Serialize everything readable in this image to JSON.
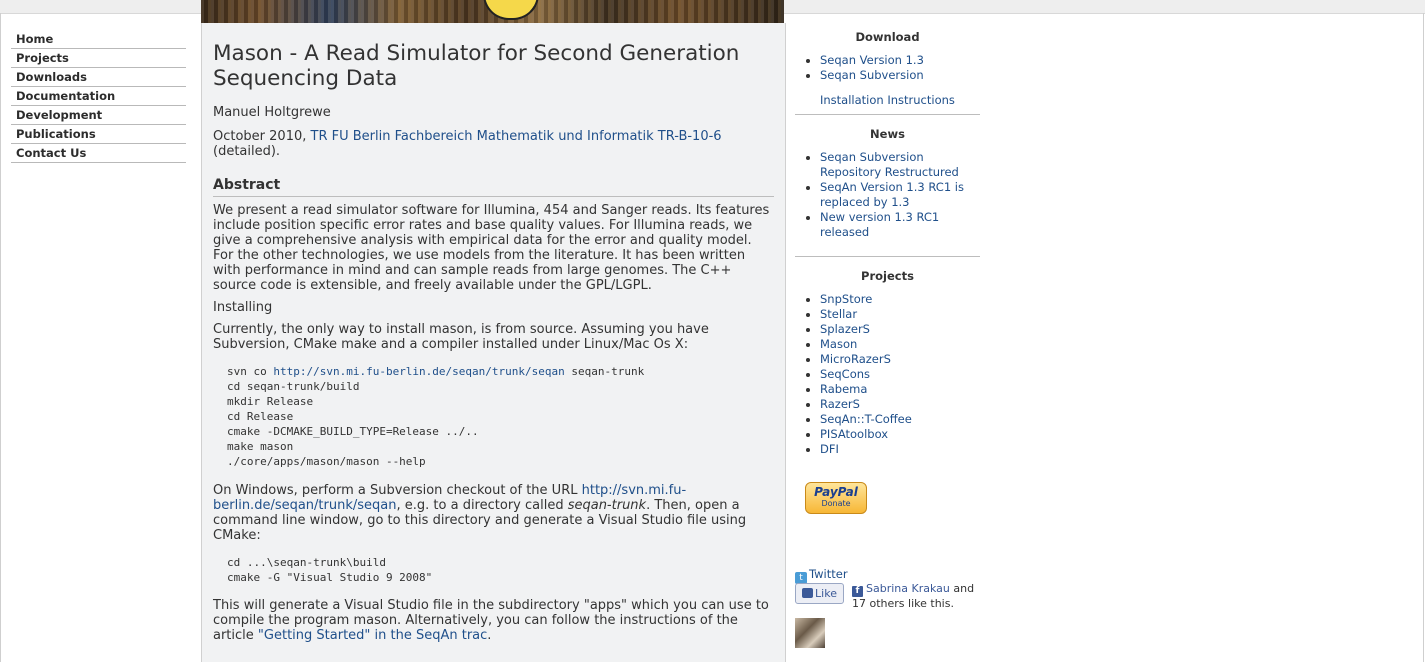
{
  "nav": {
    "items": [
      {
        "label": "Home"
      },
      {
        "label": "Projects"
      },
      {
        "label": "Downloads"
      },
      {
        "label": "Documentation"
      },
      {
        "label": "Development"
      },
      {
        "label": "Publications"
      },
      {
        "label": "Contact Us"
      }
    ]
  },
  "article": {
    "title": "Mason - A Read Simulator for Second Generation Sequencing Data",
    "author": "Manuel Holtgrewe",
    "date_prefix": "October 2010,",
    "report_link": "TR FU Berlin Fachbereich Mathematik und Informatik TR-B-10-6",
    "date_suffix": "(detailed).",
    "abstract_heading": "Abstract",
    "abstract_text": "We present a read simulator software for Illumina, 454 and Sanger reads. Its features include position specific error rates and base quality values. For Illumina reads, we give a comprehensive analysis with empirical data for the error and quality model. For the other technologies, we use models from the literature. It has been written with performance in mind and can sample reads from large genomes. The C++ source code is extensible, and freely available under the GPL/LGPL.",
    "installing_label": "Installing",
    "install_intro": "Currently, the only way to install mason, is from source. Assuming you have Subversion, CMake make and a compiler installed under Linux/Mac Os X:",
    "code1": {
      "line1_prefix": "svn co ",
      "line1_link": "http://svn.mi.fu-berlin.de/seqan/trunk/seqan",
      "line1_suffix": " seqan-trunk",
      "rest": "cd seqan-trunk/build\nmkdir Release\ncd Release\ncmake -DCMAKE_BUILD_TYPE=Release ../..\nmake mason\n./core/apps/mason/mason --help"
    },
    "windows_prefix": "On Windows, perform a Subversion checkout of the URL ",
    "windows_link": "http://svn.mi.fu-berlin.de/seqan/trunk/seqan",
    "windows_mid": ", e.g. to a directory called ",
    "windows_dir": "seqan-trunk",
    "windows_suffix": ". Then, open a command line window, go to this directory and generate a Visual Studio file using CMake:",
    "code2": "cd ...\\seqan-trunk\\build\ncmake -G \"Visual Studio 9 2008\"",
    "vs_prefix": "This will generate a Visual Studio file in the subdirectory \"apps\" which you can use to compile the program mason. Alternatively, you can follow the instructions of the article ",
    "vs_link": "\"Getting Started\" in the SeqAn trac",
    "vs_suffix": "."
  },
  "sidebar": {
    "download": {
      "title": "Download",
      "items": [
        {
          "label": "Seqan Version 1.3"
        },
        {
          "label": "Seqan Subversion"
        }
      ],
      "extra": "Installation Instructions"
    },
    "news": {
      "title": "News",
      "items": [
        {
          "label": "Seqan Subversion Repository Restructured"
        },
        {
          "label": "SeqAn Version 1.3 RC1 is replaced by 1.3"
        },
        {
          "label": "New version 1.3 RC1 released"
        }
      ]
    },
    "projects": {
      "title": "Projects",
      "items": [
        {
          "label": "SnpStore"
        },
        {
          "label": "Stellar"
        },
        {
          "label": "SplazerS"
        },
        {
          "label": "Mason"
        },
        {
          "label": "MicroRazerS"
        },
        {
          "label": "SeqCons"
        },
        {
          "label": "Rabema"
        },
        {
          "label": "RazerS"
        },
        {
          "label": "SeqAn::T-Coffee"
        },
        {
          "label": "PISAtoolbox"
        },
        {
          "label": "DFI"
        }
      ]
    },
    "paypal": {
      "brand": "PayPal",
      "label": "Donate"
    },
    "twitter": {
      "label": "Twitter"
    },
    "facebook": {
      "like_label": "Like",
      "friend_name": "Sabrina Krakau",
      "friend_suffix": "and 17 others like this."
    }
  }
}
